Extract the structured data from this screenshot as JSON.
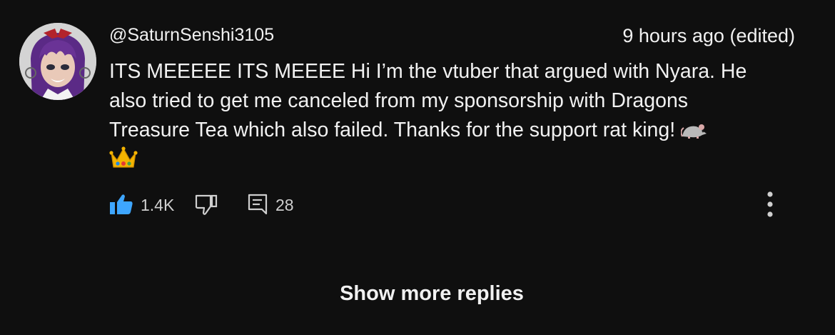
{
  "comment": {
    "author": "@SaturnSenshi3105",
    "timestamp": "9 hours ago (edited)",
    "lines": [
      "ITS MEEEEE ITS MEEEE Hi I’m the vtuber that argued with Nyara. He",
      "also tried to get me canceled from my sponsorship with Dragons",
      "Treasure Tea which also failed. Thanks for the support rat king!"
    ],
    "emojis": [
      "rat-emoji",
      "crown-emoji"
    ],
    "like_count": "1.4K",
    "reply_count": "28",
    "liked": true,
    "accent_color": "#3ea6ff"
  },
  "replies": {
    "show_more_label": "Show more replies"
  }
}
